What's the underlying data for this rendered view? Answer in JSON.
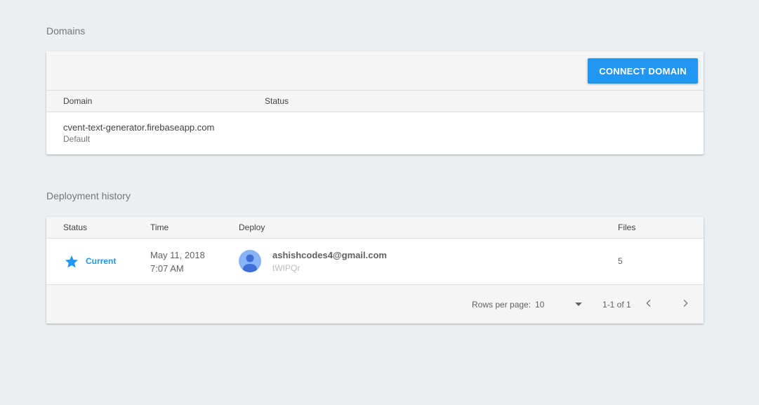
{
  "domains": {
    "section_title": "Domains",
    "connect_button": "CONNECT DOMAIN",
    "columns": {
      "domain": "Domain",
      "status": "Status"
    },
    "rows": [
      {
        "domain": "cvent-text-generator.firebaseapp.com",
        "subtitle": "Default",
        "status": ""
      }
    ]
  },
  "deployments": {
    "section_title": "Deployment history",
    "columns": {
      "status": "Status",
      "time": "Time",
      "deploy": "Deploy",
      "files": "Files"
    },
    "rows": [
      {
        "status": "Current",
        "date": "May 11, 2018",
        "time": "7:07 AM",
        "email": "ashishcodes4@gmail.com",
        "id": "tWIPQr",
        "files": "5"
      }
    ],
    "footer": {
      "rows_per_page_label": "Rows per page:",
      "rows_per_page_value": "10",
      "range": "1-1 of 1"
    }
  },
  "colors": {
    "accent": "#2196f3",
    "background": "#eceff1",
    "header_bg": "#f5f5f5"
  },
  "icons": {
    "status_icon": "star-icon",
    "avatar_icon": "person-icon",
    "dropdown": "arrow-drop-down-icon",
    "prev": "chevron-left-icon",
    "next": "chevron-right-icon"
  }
}
